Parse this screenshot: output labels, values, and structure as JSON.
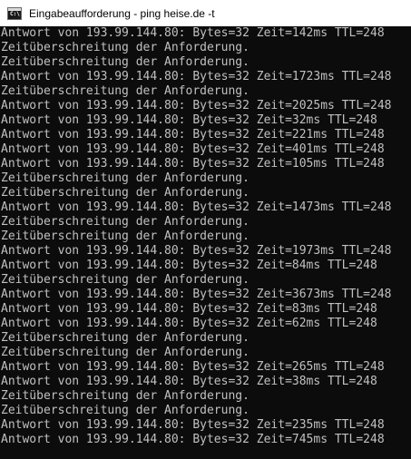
{
  "window": {
    "title": "Eingabeaufforderung - ping  heise.de -t",
    "icon": "cmd-icon",
    "icon_prompt": "C:\\",
    "colors": {
      "background": "#0c0c0c",
      "text": "#c0c0c0",
      "titlebar": "#ffffff"
    }
  },
  "console": {
    "lines": [
      "Antwort von 193.99.144.80: Bytes=32 Zeit=142ms TTL=248",
      "Zeitüberschreitung der Anforderung.",
      "Zeitüberschreitung der Anforderung.",
      "Antwort von 193.99.144.80: Bytes=32 Zeit=1723ms TTL=248",
      "Zeitüberschreitung der Anforderung.",
      "Antwort von 193.99.144.80: Bytes=32 Zeit=2025ms TTL=248",
      "Antwort von 193.99.144.80: Bytes=32 Zeit=32ms TTL=248",
      "Antwort von 193.99.144.80: Bytes=32 Zeit=221ms TTL=248",
      "Antwort von 193.99.144.80: Bytes=32 Zeit=401ms TTL=248",
      "Antwort von 193.99.144.80: Bytes=32 Zeit=105ms TTL=248",
      "Zeitüberschreitung der Anforderung.",
      "Zeitüberschreitung der Anforderung.",
      "Antwort von 193.99.144.80: Bytes=32 Zeit=1473ms TTL=248",
      "Zeitüberschreitung der Anforderung.",
      "Zeitüberschreitung der Anforderung.",
      "Antwort von 193.99.144.80: Bytes=32 Zeit=1973ms TTL=248",
      "Antwort von 193.99.144.80: Bytes=32 Zeit=84ms TTL=248",
      "Zeitüberschreitung der Anforderung.",
      "Antwort von 193.99.144.80: Bytes=32 Zeit=3673ms TTL=248",
      "Antwort von 193.99.144.80: Bytes=32 Zeit=83ms TTL=248",
      "Antwort von 193.99.144.80: Bytes=32 Zeit=62ms TTL=248",
      "Zeitüberschreitung der Anforderung.",
      "Zeitüberschreitung der Anforderung.",
      "Antwort von 193.99.144.80: Bytes=32 Zeit=265ms TTL=248",
      "Antwort von 193.99.144.80: Bytes=32 Zeit=38ms TTL=248",
      "Zeitüberschreitung der Anforderung.",
      "Zeitüberschreitung der Anforderung.",
      "Antwort von 193.99.144.80: Bytes=32 Zeit=235ms TTL=248",
      "Antwort von 193.99.144.80: Bytes=32 Zeit=745ms TTL=248"
    ]
  }
}
